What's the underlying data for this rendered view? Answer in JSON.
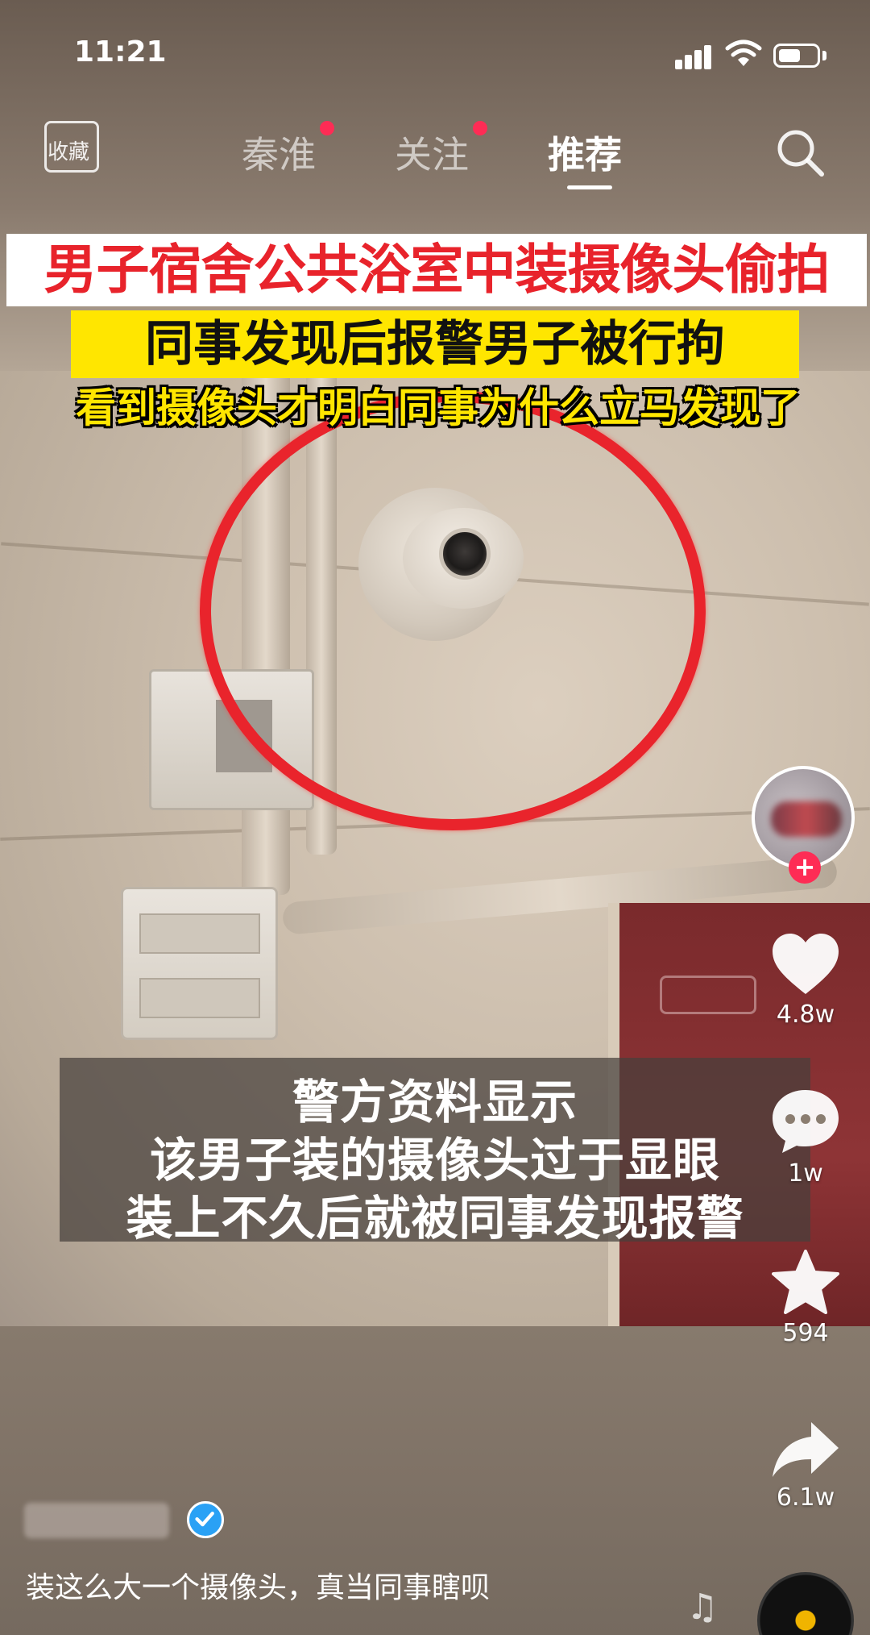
{
  "status_bar": {
    "time": "11:21"
  },
  "top_nav": {
    "collect_label": "收藏",
    "tabs": [
      {
        "label": "秦淮",
        "has_dot": true
      },
      {
        "label": "关注",
        "has_dot": true
      },
      {
        "label": "推荐",
        "active": true
      }
    ]
  },
  "video": {
    "headline_1": "男子宿舍公共浴室中装摄像头偷拍",
    "headline_2": "同事发现后报警男子被行拘",
    "headline_3": "看到摄像头才明白同事为什么立马发现了",
    "subtitles": [
      "警方资料显示",
      "该男子装的摄像头过于显眼",
      "装上不久后就被同事发现报警"
    ]
  },
  "actions": {
    "like_count": "4.8w",
    "comment_count": "1w",
    "favorite_count": "594",
    "share_count": "6.1w"
  },
  "post": {
    "caption": "装这么大一个摄像头，真当同事瞎呗"
  },
  "colors": {
    "accent": "#fe2c55",
    "headline_red": "#e8232b",
    "headline_yellow": "#ffe600",
    "verified_blue": "#2aa1f5"
  }
}
